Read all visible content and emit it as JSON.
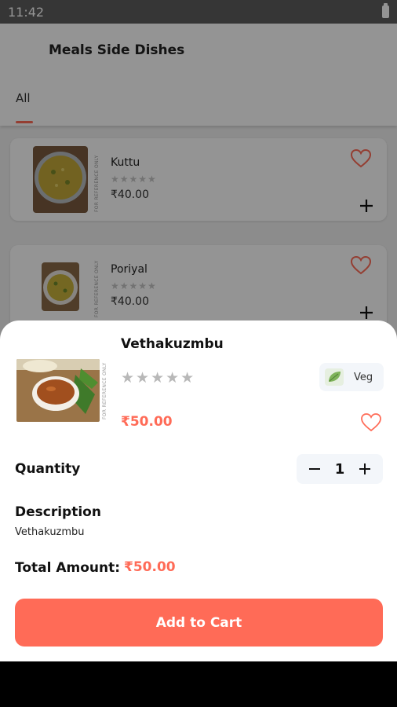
{
  "status_bar": {
    "time": "11:42",
    "battery_icon": "battery-icon"
  },
  "header": {
    "title": "Meals Side Dishes",
    "tabs": [
      {
        "label": "All",
        "active": true
      }
    ]
  },
  "accent_color": "#ff6b57",
  "items": [
    {
      "name": "Kuttu",
      "stars": "★★★★★",
      "price": "₹40.00",
      "ref_note": "FOR REFERENCE ONLY"
    },
    {
      "name": "Poriyal",
      "stars": "★★★★★",
      "price": "₹40.00",
      "ref_note": "FOR REFERENCE ONLY"
    }
  ],
  "sheet": {
    "dish_name": "Vethakuzmbu",
    "stars": "★★★★★",
    "ref_note": "FOR REFERENCE ONLY",
    "veg_label": "Veg",
    "price": "₹50.00",
    "quantity_label": "Quantity",
    "quantity": "1",
    "description_label": "Description",
    "description": "Vethakuzmbu",
    "total_label": "Total Amount:",
    "total_value": "₹50.00",
    "add_to_cart": "Add to Cart"
  }
}
